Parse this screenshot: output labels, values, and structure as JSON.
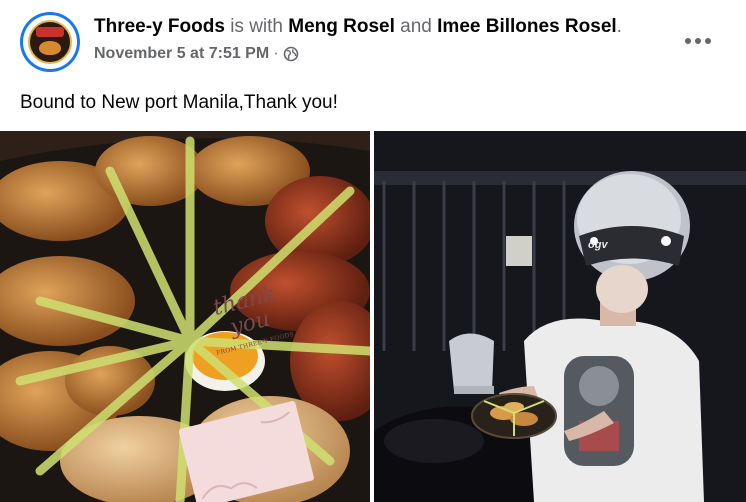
{
  "post": {
    "author": "Three-y Foods",
    "connector": "is with",
    "tagged_1": "Meng Rosel",
    "joiner": "and",
    "tagged_2": "Imee Billones Rosel",
    "end_period": ".",
    "date": "November 5 at 7:51 PM",
    "separator": "·",
    "privacy_icon": "globe-icon",
    "more_icon": "more-options-icon",
    "caption": "Bound to New port Manila,Thank you!"
  },
  "photos": {
    "left": {
      "card_line1": "thank",
      "card_line2": "you",
      "card_footer": "FROM THREE-Y FOODS"
    },
    "right": {
      "helmet_text": "ogv"
    }
  },
  "colors": {
    "link_blue": "#1877f2",
    "muted_text": "#65676b",
    "text": "#050505"
  }
}
